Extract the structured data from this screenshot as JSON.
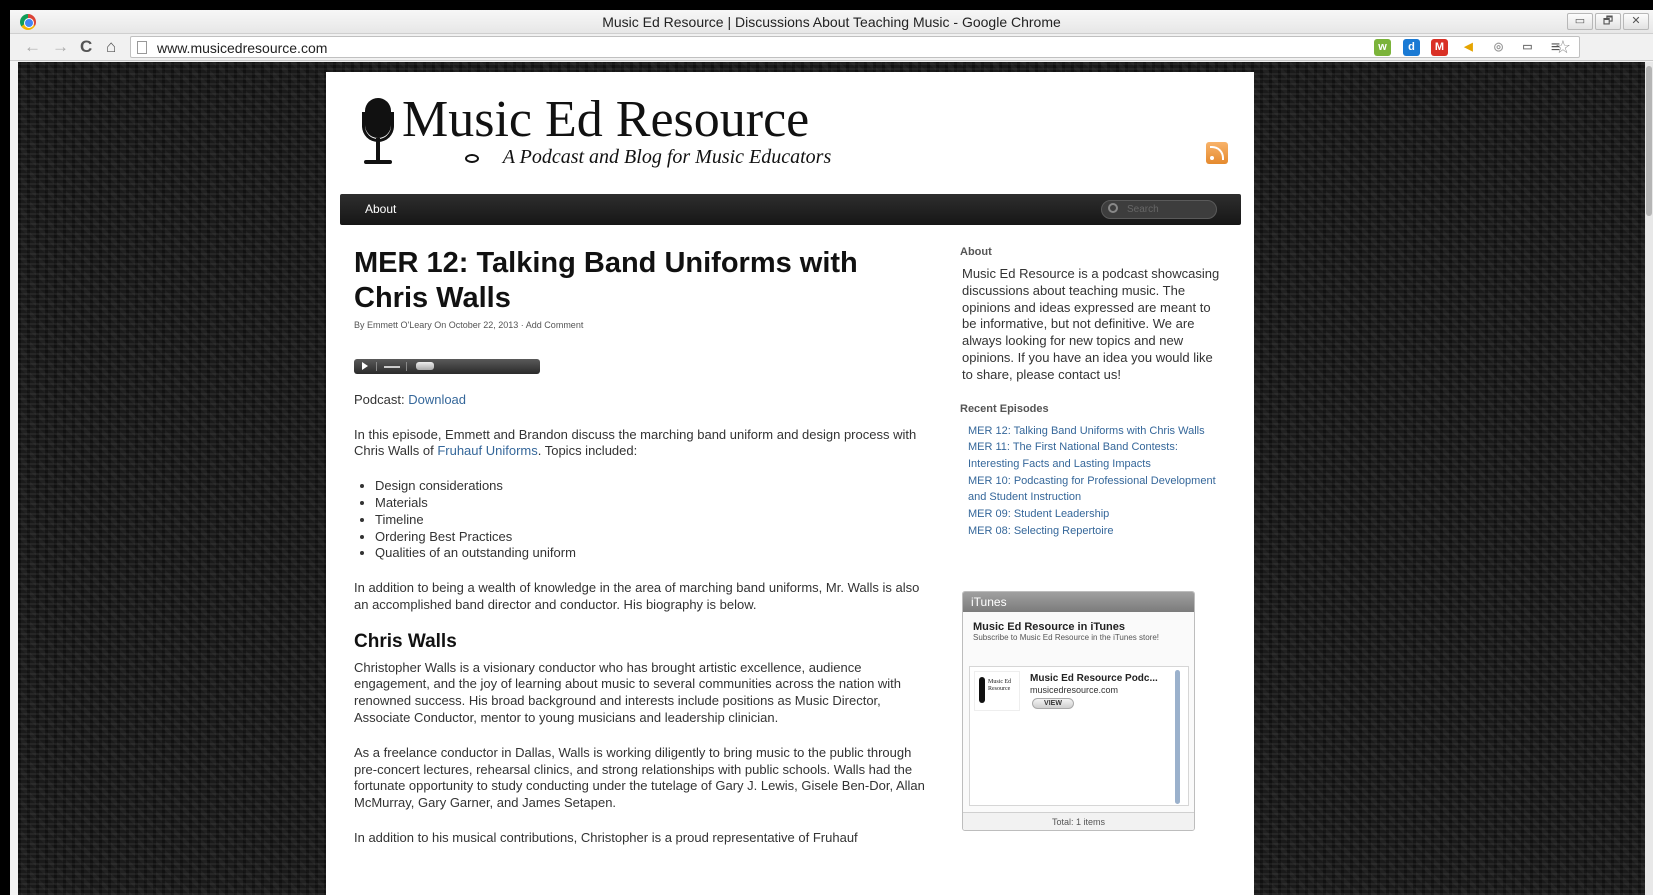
{
  "browser": {
    "window_title": "Music Ed Resource | Discussions About Teaching Music - Google Chrome",
    "url": "www.musicedresource.com",
    "back_glyph": "←",
    "forward_glyph": "→",
    "reload_glyph": "C",
    "home_glyph": "⌂",
    "star_glyph": "☆",
    "window_controls": [
      "▭",
      "🗗",
      "✕"
    ],
    "extensions": [
      {
        "name": "w-extension-icon",
        "label": "w",
        "color": "#7bb33a"
      },
      {
        "name": "d-extension-icon",
        "label": "d",
        "color": "#1a7ad4"
      },
      {
        "name": "gmail-icon",
        "label": "M",
        "color": "#d93025"
      },
      {
        "name": "bell-extension-icon",
        "label": "◀",
        "color": "#e5a400"
      },
      {
        "name": "pin-extension-icon",
        "label": "◎",
        "color": "#9a9a9a"
      },
      {
        "name": "cast-icon",
        "label": "▭",
        "color": "#777777"
      },
      {
        "name": "menu-icon",
        "label": "≡",
        "color": "#555555"
      }
    ]
  },
  "header": {
    "logo_title": "Music Ed Resource",
    "logo_tagline": "A Podcast and Blog for Music Educators",
    "rss_icon": "rss-icon"
  },
  "nav": {
    "about_label": "About",
    "search_placeholder": "Search"
  },
  "post": {
    "title": "MER 12: Talking Band Uniforms with Chris Walls",
    "byline_prefix": "By Emmett O'Leary On October 22, 2013 · ",
    "add_comment": "Add Comment",
    "podcast_label": "Podcast: ",
    "download_label": "Download",
    "intro_text_1": "In this episode, Emmett and Brandon discuss the marching band uniform and design process with Chris Walls of ",
    "intro_link": "Fruhauf Uniforms",
    "intro_text_2": ". Topics included:",
    "topics": [
      "Design considerations",
      "Materials",
      "Timeline",
      "Ordering Best Practices",
      "Qualities of an outstanding uniform"
    ],
    "addition_para": "In addition to being a wealth of knowledge in the area of marching band uniforms, Mr. Walls is also an accomplished band director and conductor. His biography is below.",
    "bio_heading": "Chris Walls",
    "bio_para_1": "Christopher Walls is a visionary conductor who has brought artistic excellence, audience engagement, and the joy of learning about music to several communities across the nation with renowned success. His broad background and interests include positions as Music Director, Associate Conductor, mentor to young musicians and leadership clinician.",
    "bio_para_2": "As a freelance conductor in Dallas, Walls is working diligently to bring music to the public through pre-concert lectures, rehearsal clinics, and strong relationships with public schools. Walls had the fortunate opportunity to study conducting under the tutelage of Gary J. Lewis, Gisele Ben-Dor, Allan McMurray, Gary Garner, and James Setapen.",
    "bio_para_3_partial": "In addition to his musical contributions, Christopher is a proud representative of Fruhauf"
  },
  "sidebar": {
    "about_heading": "About",
    "about_text": "Music Ed Resource is a podcast showcasing discussions about teaching music. The opinions and ideas expressed are meant to be informative, but not definitive. We are always looking for new topics and new opinions. If you have an idea you would like to share, please contact us!",
    "recent_heading": "Recent Episodes",
    "recent_episodes": [
      "MER 12: Talking Band Uniforms with Chris Walls",
      "MER 11: The First National Band Contests: Interesting Facts and Lasting Impacts",
      "MER 10: Podcasting for Professional Development and Student Instruction",
      "MER 09: Student Leadership",
      "MER 08: Selecting Repertoire"
    ],
    "itunes": {
      "header": "iTunes",
      "title": "Music Ed Resource in iTunes",
      "subtitle": "Subscribe to Music Ed Resource in the iTunes store!",
      "thumb_text": "Music Ed Resource",
      "podcast_name": "Music Ed Resource Podc...",
      "domain": "musicedresource.com",
      "view_label": "VIEW",
      "total": "Total: 1 items"
    }
  }
}
